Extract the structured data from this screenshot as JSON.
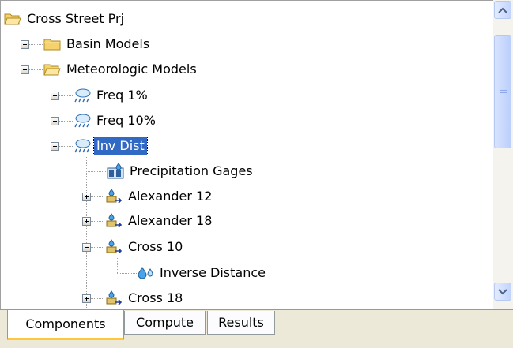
{
  "tree": {
    "root": "Cross Street Prj",
    "basin_models": "Basin Models",
    "meteorologic_models": "Meteorologic Models",
    "freq1": "Freq 1%",
    "freq10": "Freq 10%",
    "inv_dist": "Inv Dist",
    "precip_gages": "Precipitation Gages",
    "alexander12": "Alexander 12",
    "alexander18": "Alexander 18",
    "cross10": "Cross 10",
    "inverse_distance": "Inverse Distance",
    "cross18": "Cross 18"
  },
  "tabs": {
    "components": "Components",
    "compute": "Compute",
    "results": "Results"
  },
  "colors": {
    "selection": "#316ac5",
    "folder": "#f5d26b",
    "tab_highlight": "#ffc83c"
  }
}
